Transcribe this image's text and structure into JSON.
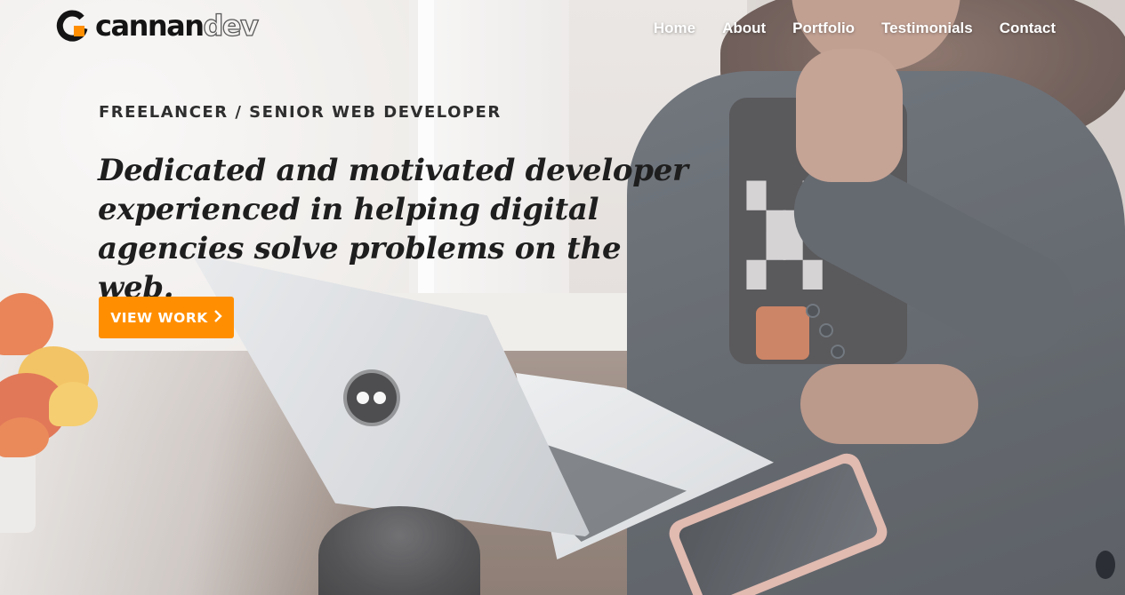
{
  "brand": {
    "part1": "cannan",
    "part2": "dev",
    "mark_color": "#ff8f00"
  },
  "nav": {
    "items": [
      {
        "label": "Home"
      },
      {
        "label": "About"
      },
      {
        "label": "Portfolio"
      },
      {
        "label": "Testimonials"
      },
      {
        "label": "Contact"
      }
    ]
  },
  "hero": {
    "eyebrow": "FREELANCER / SENIOR WEB DEVELOPER",
    "headline": "Dedicated and motivated developer experienced in helping digital agencies solve problems on the web.",
    "cta_label": "VIEW WORK",
    "cta_icon": "chevron-right-icon",
    "cta_color": "#ff8f00"
  }
}
